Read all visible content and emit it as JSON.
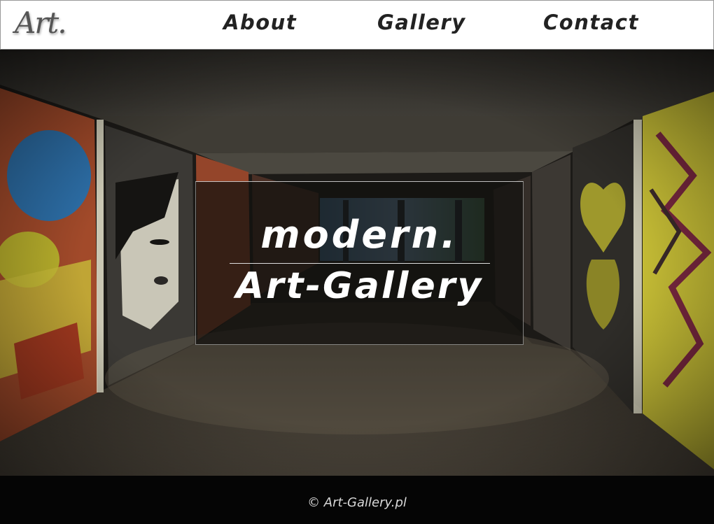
{
  "header": {
    "logo_text": "Art.",
    "nav": [
      {
        "label": "About"
      },
      {
        "label": "Gallery"
      },
      {
        "label": "Contact"
      }
    ]
  },
  "hero": {
    "line1": "modern.",
    "line2": "Art-Gallery",
    "background_description_colors": {
      "ceiling": "#3a3833",
      "floor": "#4a443a",
      "wall_left": "#b4502c",
      "wall_right": "#c9c23a",
      "tunnel_end": "#5a86a8"
    }
  },
  "footer": {
    "copyright": "© Art-Gallery.pl"
  }
}
